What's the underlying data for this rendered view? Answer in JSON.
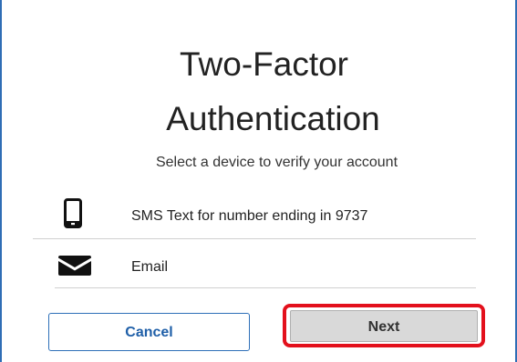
{
  "dialog": {
    "title_line1": "Two-Factor",
    "title_line2": "Authentication",
    "subtitle": "Select a device to verify your account"
  },
  "devices": [
    {
      "icon": "smartphone-icon",
      "label": "SMS Text for number ending in 9737"
    },
    {
      "icon": "envelope-icon",
      "label": "Email"
    }
  ],
  "buttons": {
    "cancel_label": "Cancel",
    "next_label": "Next"
  },
  "colors": {
    "frame": "#2f6db5",
    "cancel_text": "#1f5fa8",
    "next_background": "#d9d9d9",
    "highlight": "#e3101c"
  }
}
